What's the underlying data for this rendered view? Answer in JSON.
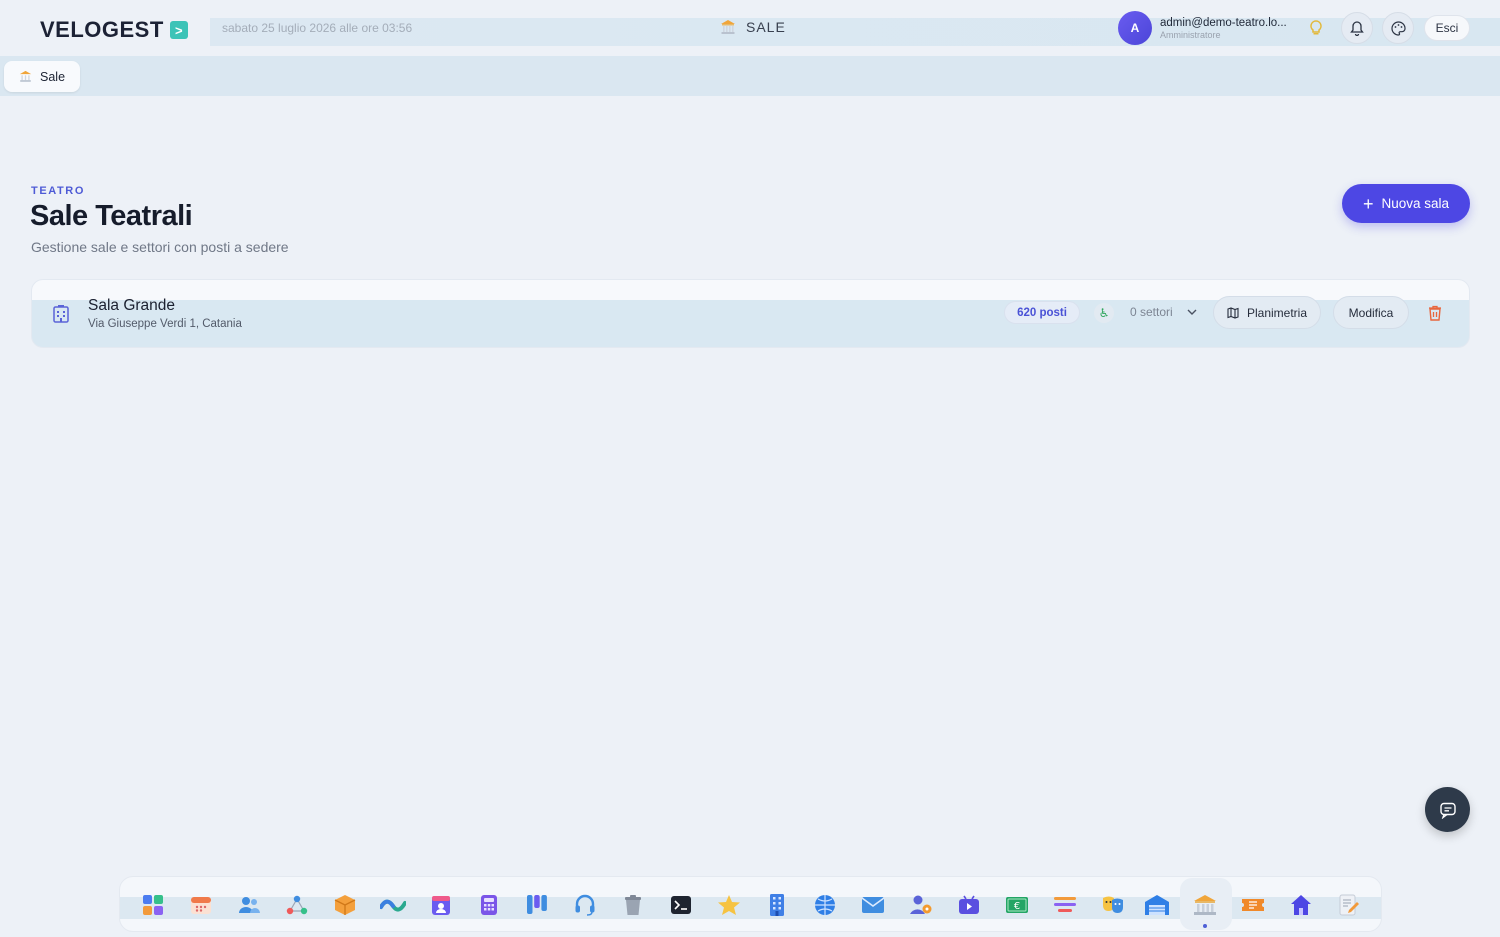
{
  "app": {
    "logo": "VELOGEST",
    "logo_badge": ">"
  },
  "header": {
    "datetime": "sabato 25 luglio 2026 alle ore 03:56",
    "section_title": "SALE",
    "user": {
      "initial": "A",
      "email": "admin@demo-teatro.lo...",
      "role": "Amministratore"
    },
    "logout_label": "Esci",
    "icons": [
      "lightbulb-icon",
      "bell-icon",
      "palette-icon"
    ]
  },
  "tabs": [
    {
      "label": "Sale",
      "icon": "temple-icon",
      "active": true
    }
  ],
  "page": {
    "eyebrow": "TEATRO",
    "title": "Sale Teatrali",
    "subtitle": "Gestione sale e settori con posti a sedere",
    "new_button": "Nuova sala"
  },
  "halls": [
    {
      "name": "Sala Grande",
      "address": "Via Giuseppe Verdi 1, Catania",
      "seats_badge": "620 posti",
      "sectors": "0 settori",
      "plan_label": "Planimetria",
      "edit_label": "Modifica"
    }
  ],
  "dock": {
    "items": [
      "dashboard-icon",
      "calendar-icon",
      "users-icon",
      "network-icon",
      "box-icon",
      "wave-icon",
      "badge-icon",
      "calculator-icon",
      "kanban-icon",
      "headset-icon",
      "trash-icon",
      "terminal-icon",
      "star-icon",
      "building-icon",
      "globe-icon",
      "mail-icon",
      "user-settings-icon",
      "video-icon",
      "money-icon",
      "list-icon",
      "theater-masks-icon",
      "warehouse-icon",
      "temple-icon",
      "ticket-icon",
      "home-icon",
      "edit-doc-icon"
    ],
    "active": "temple-icon"
  },
  "colors": {
    "accent": "#4d47e4",
    "teal": "#3cc3b7",
    "danger": "#e8663d"
  }
}
